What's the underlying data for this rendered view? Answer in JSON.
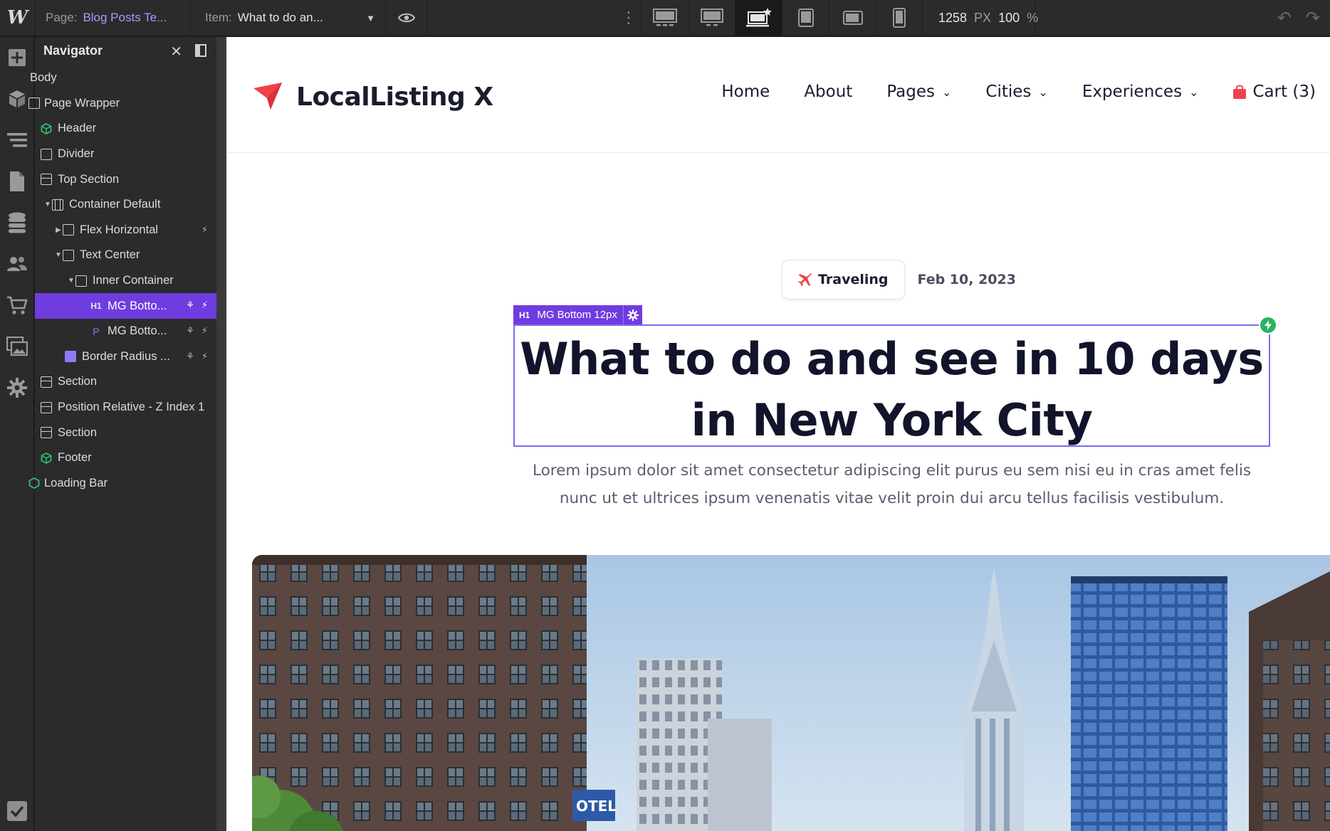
{
  "topbar": {
    "page_label": "Page:",
    "page_value": "Blog Posts Te...",
    "item_label": "Item:",
    "item_value": "What to do an...",
    "width_value": "1258",
    "width_unit": "PX",
    "zoom_value": "100",
    "zoom_unit": "%"
  },
  "navigator": {
    "title": "Navigator",
    "items": [
      {
        "label": "Body"
      },
      {
        "label": "Page Wrapper"
      },
      {
        "label": "Header"
      },
      {
        "label": "Divider"
      },
      {
        "label": "Top Section"
      },
      {
        "label": "Container Default"
      },
      {
        "label": "Flex Horizontal"
      },
      {
        "label": "Text Center"
      },
      {
        "label": "Inner Container"
      },
      {
        "label": "MG Botto..."
      },
      {
        "label": "MG Botto..."
      },
      {
        "label": "Border Radius ..."
      },
      {
        "label": "Section"
      },
      {
        "label": "Position Relative - Z Index 1"
      },
      {
        "label": "Section"
      },
      {
        "label": "Footer"
      },
      {
        "label": "Loading Bar"
      }
    ]
  },
  "site": {
    "brand": "LocalListing X",
    "menu": {
      "home": "Home",
      "about": "About",
      "pages": "Pages",
      "cities": "Cities",
      "experiences": "Experiences",
      "cart": "Cart (3)"
    },
    "tag": "Traveling",
    "date": "Feb 10, 2023",
    "selection_tag": "H1",
    "selection_label": "MG Bottom 12px",
    "heading": "What to do and see in 10 days in New York City",
    "lead": "Lorem ipsum dolor sit amet consectetur adipiscing elit purus eu sem nisi eu in cras amet felis nunc ut et ultrices ipsum venenatis vitae velit proin dui arcu tellus facilisis vestibulum."
  },
  "colors": {
    "accent": "#6f3ce0",
    "brand_red": "#f0424b",
    "success": "#27b360"
  },
  "icons": [
    "eye-icon",
    "desktop-icon",
    "laptop-icon",
    "tablet-icon",
    "phone-icon",
    "undo-icon",
    "redo-icon",
    "add-icon",
    "cube-icon",
    "layers-icon",
    "page-icon",
    "database-icon",
    "users-icon",
    "cart-icon",
    "assets-icon",
    "gear-icon",
    "check-icon",
    "plane-icon",
    "bolt-icon"
  ]
}
